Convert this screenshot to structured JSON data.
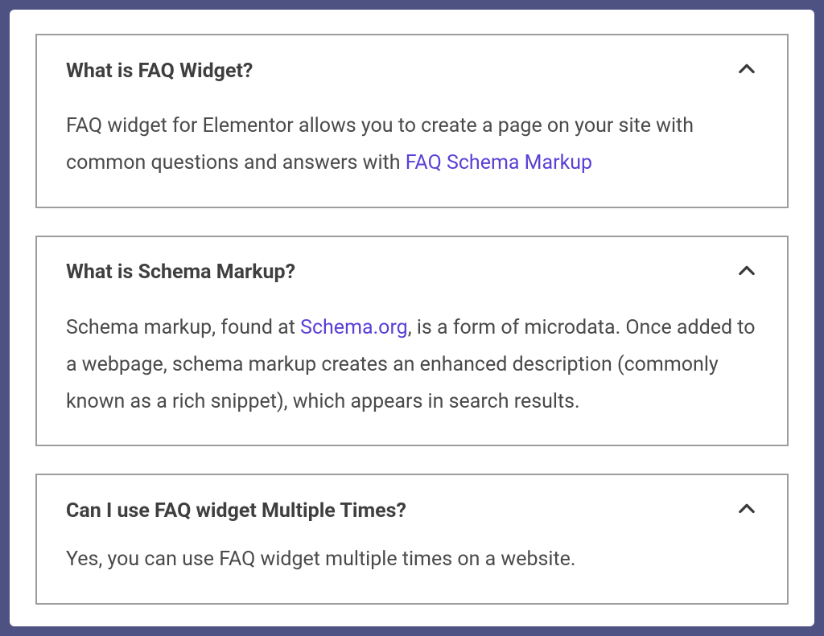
{
  "colors": {
    "page_bg": "#4e5283",
    "card_border": "#9d9d9d",
    "link": "#5b3fd6",
    "heading": "#3f3f3f",
    "body": "#4a4a4a"
  },
  "faq": [
    {
      "question": "What is FAQ Widget?",
      "answer_before": "FAQ widget for Elementor allows you to create a page on your site with common questions and answers with ",
      "link_text": "FAQ Schema Markup",
      "answer_after": "",
      "expanded": true
    },
    {
      "question": "What is Schema Markup?",
      "answer_before": "Schema markup, found at ",
      "link_text": "Schema.org",
      "answer_after": ", is a form of microdata. Once added to a webpage, schema markup creates an enhanced description (commonly known as a rich snippet), which appears in search results.",
      "expanded": true
    },
    {
      "question": "Can I use FAQ widget Multiple Times?",
      "answer_before": "Yes, you can use FAQ widget multiple times on a website.",
      "link_text": "",
      "answer_after": "",
      "expanded": true
    }
  ]
}
